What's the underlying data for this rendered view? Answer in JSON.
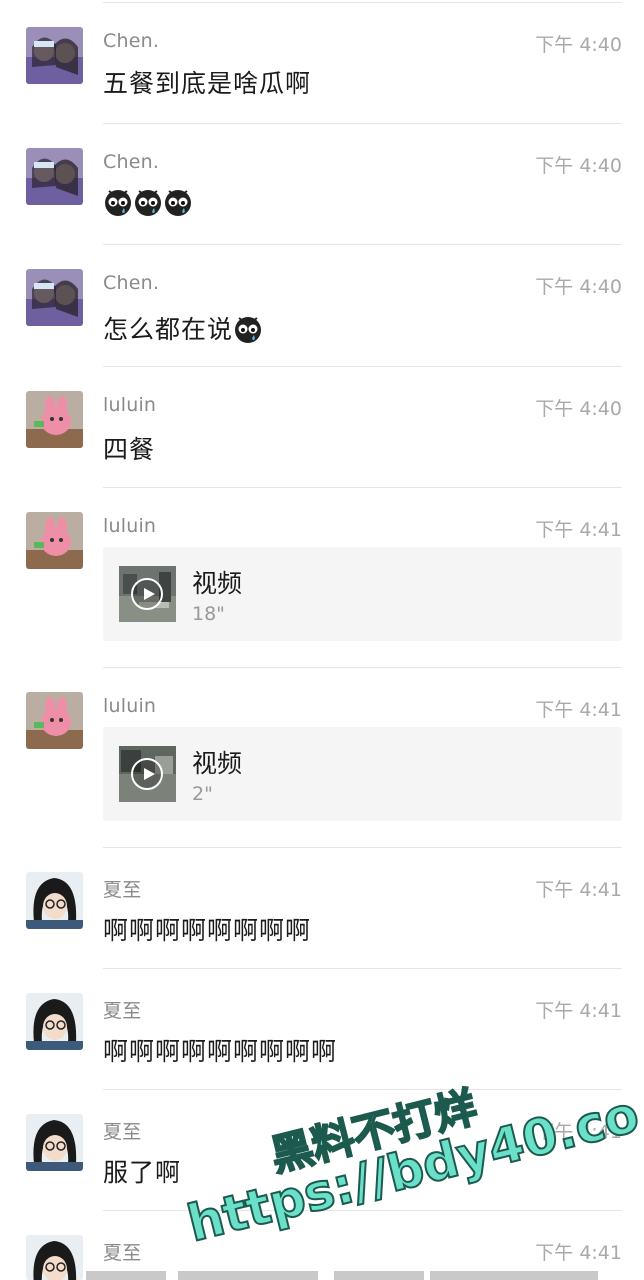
{
  "messages": [
    {
      "name": "Chen.",
      "time": "下午 4:40",
      "text": "五餐到底是啥瓜啊"
    },
    {
      "name": "Chen.",
      "time": "下午 4:40",
      "emoji_count": 3
    },
    {
      "name": "Chen.",
      "time": "下午 4:40",
      "text": "怎么都在说"
    },
    {
      "name": "luluin",
      "time": "下午 4:40",
      "text": "四餐"
    },
    {
      "name": "luluin",
      "time": "下午 4:41",
      "video_title": "视频",
      "video_duration": "18\""
    },
    {
      "name": "luluin",
      "time": "下午 4:41",
      "video_title": "视频",
      "video_duration": "2\""
    },
    {
      "name": "夏至",
      "time": "下午 4:41",
      "text": "啊啊啊啊啊啊啊啊"
    },
    {
      "name": "夏至",
      "time": "下午 4:41",
      "text": "啊啊啊啊啊啊啊啊啊"
    },
    {
      "name": "夏至",
      "time": "下午 4:41",
      "text": "服了啊"
    },
    {
      "name": "夏至",
      "time": "下午 4:41"
    }
  ],
  "watermark": {
    "line1": "黑料不打烊",
    "line2": "https://bdy40.co"
  },
  "colors": {
    "name": "#8a8a8a",
    "time": "#a9a9a9",
    "watermark": "#6be0c8"
  }
}
